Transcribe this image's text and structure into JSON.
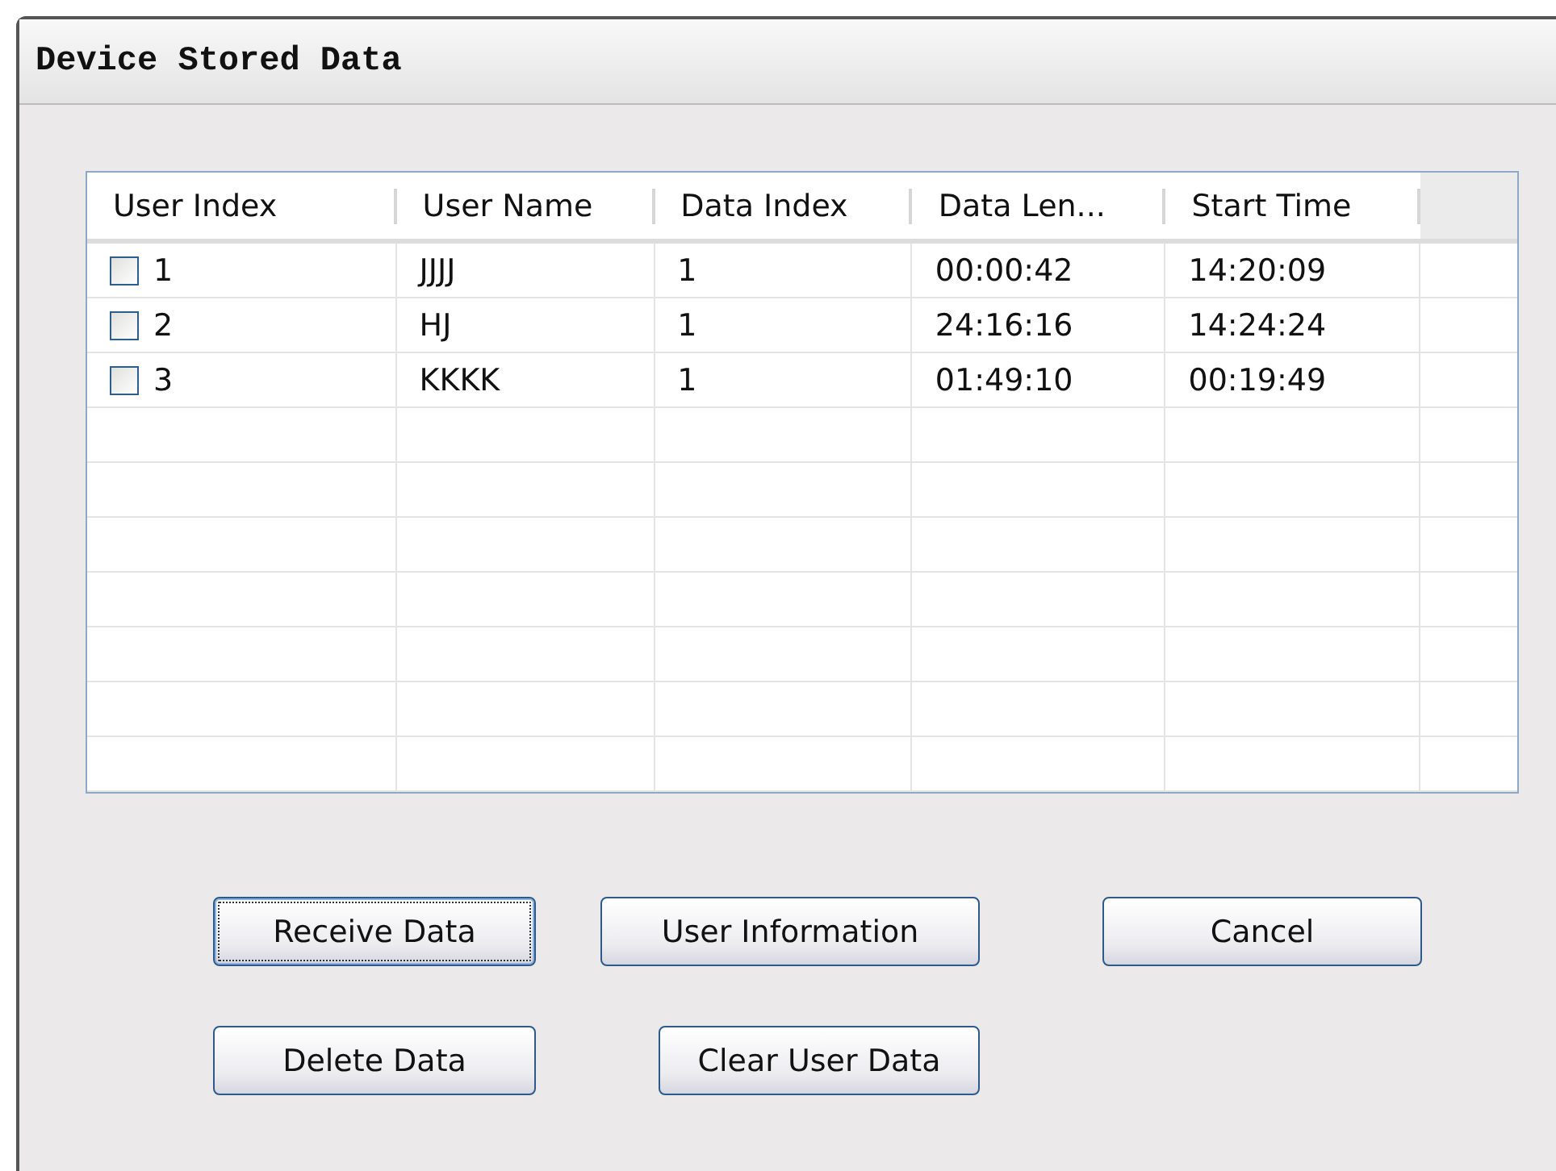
{
  "window": {
    "title": "Device Stored Data"
  },
  "table": {
    "columns": [
      "User Index",
      "User Name",
      "Data Index",
      "Data Len...",
      "Start Time"
    ],
    "rows": [
      {
        "checked": false,
        "cells": [
          "1",
          "JJJJ",
          "1",
          "00:00:42",
          "14:20:09"
        ]
      },
      {
        "checked": false,
        "cells": [
          "2",
          "HJ",
          "1",
          "24:16:16",
          "14:24:24"
        ]
      },
      {
        "checked": false,
        "cells": [
          "3",
          "KKKK",
          "1",
          "01:49:10",
          "00:19:49"
        ]
      }
    ]
  },
  "buttons": [
    {
      "label": "Receive Data",
      "focused": true
    },
    {
      "label": "User Information",
      "focused": false
    },
    {
      "label": "Cancel",
      "focused": false
    },
    {
      "label": "Delete Data",
      "focused": false
    },
    {
      "label": "Clear User Data",
      "focused": false
    }
  ]
}
